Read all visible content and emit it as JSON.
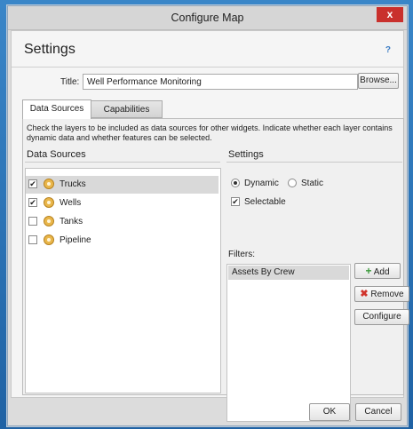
{
  "window": {
    "title": "Configure Map",
    "close_label": "x"
  },
  "header": {
    "settings_title": "Settings",
    "help_label": "?"
  },
  "title_field": {
    "label": "Title:",
    "value": "Well Performance Monitoring",
    "browse_label": "Browse..."
  },
  "tabs": [
    {
      "label": "Data Sources"
    },
    {
      "label": "Capabilities"
    }
  ],
  "description": "Check the layers to be included as data sources for other widgets. Indicate whether each layer contains dynamic data and whether features can be selected.",
  "data_sources": {
    "header": "Data Sources",
    "layers": [
      {
        "label": "Trucks",
        "checked": true,
        "selected": true,
        "check_glyph": "✔"
      },
      {
        "label": "Wells",
        "checked": true,
        "selected": false,
        "check_glyph": "✔"
      },
      {
        "label": "Tanks",
        "checked": false,
        "selected": false,
        "check_glyph": ""
      },
      {
        "label": "Pipeline",
        "checked": false,
        "selected": false,
        "check_glyph": ""
      }
    ]
  },
  "settings_panel": {
    "header": "Settings",
    "dynamic_label": "Dynamic",
    "static_label": "Static",
    "selectable_label": "Selectable",
    "selectable_glyph": "✔",
    "filters_label": "Filters:",
    "filters": [
      "Assets By Crew"
    ],
    "add_label": "Add",
    "remove_label": "Remove",
    "configure_label": "Configure"
  },
  "footer": {
    "ok_label": "OK",
    "cancel_label": "Cancel"
  },
  "colors": {
    "add_icon": "#3c9a3c",
    "remove_icon": "#d0342c",
    "layer_icon": "#e9b64a"
  }
}
